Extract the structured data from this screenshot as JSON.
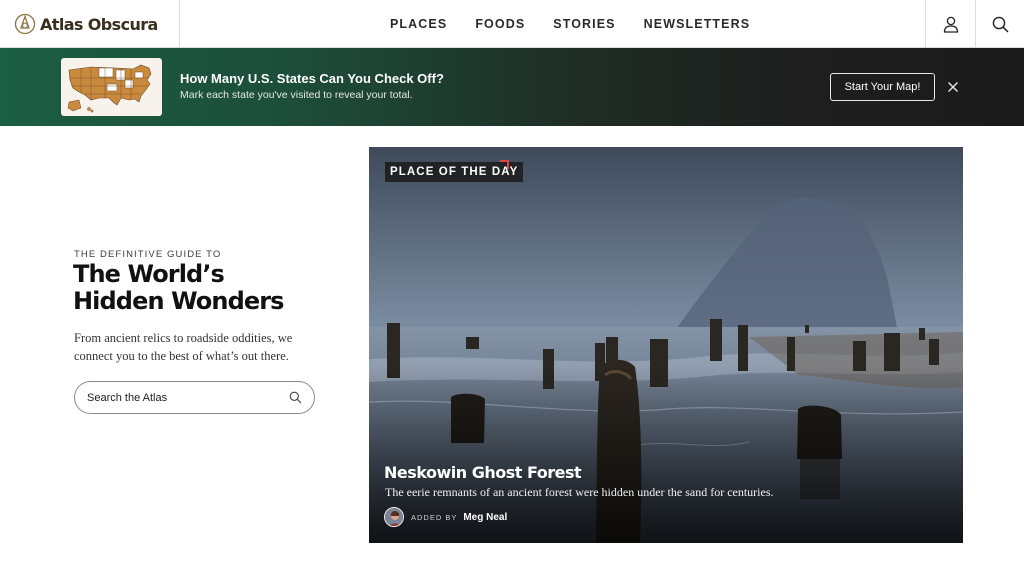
{
  "header": {
    "brand": "Atlas Obscura",
    "nav": [
      "PLACES",
      "FOODS",
      "STORIES",
      "NEWSLETTERS"
    ],
    "icons": {
      "account": "user-icon",
      "search": "search-icon"
    }
  },
  "banner": {
    "title": "How Many U.S. States Can You Check Off?",
    "subtitle": "Mark each state you've visited to reveal your total.",
    "cta": "Start Your Map!",
    "close_icon": "close-icon"
  },
  "hero": {
    "eyebrow": "THE DEFINITIVE GUIDE TO",
    "title_line1": "The World’s",
    "title_line2": "Hidden Wonders",
    "description": "From ancient relics to roadside oddities, we connect you to the best of what’s out there.",
    "search_placeholder": "Search the Atlas"
  },
  "place_of_day": {
    "badge": "PLACE OF THE DAY",
    "title": "Neskowin Ghost Forest",
    "subtitle": "The eerie remnants of an ancient forest were hidden under the sand for centuries.",
    "added_by_label": "ADDED BY",
    "author": "Meg Neal"
  },
  "colors": {
    "banner_start": "#1b5e43",
    "banner_end": "#1a1a1a",
    "brand_text": "#3a2f1d",
    "badge_accent": "#e0473c",
    "map_state_fill": "#c98a3e"
  }
}
